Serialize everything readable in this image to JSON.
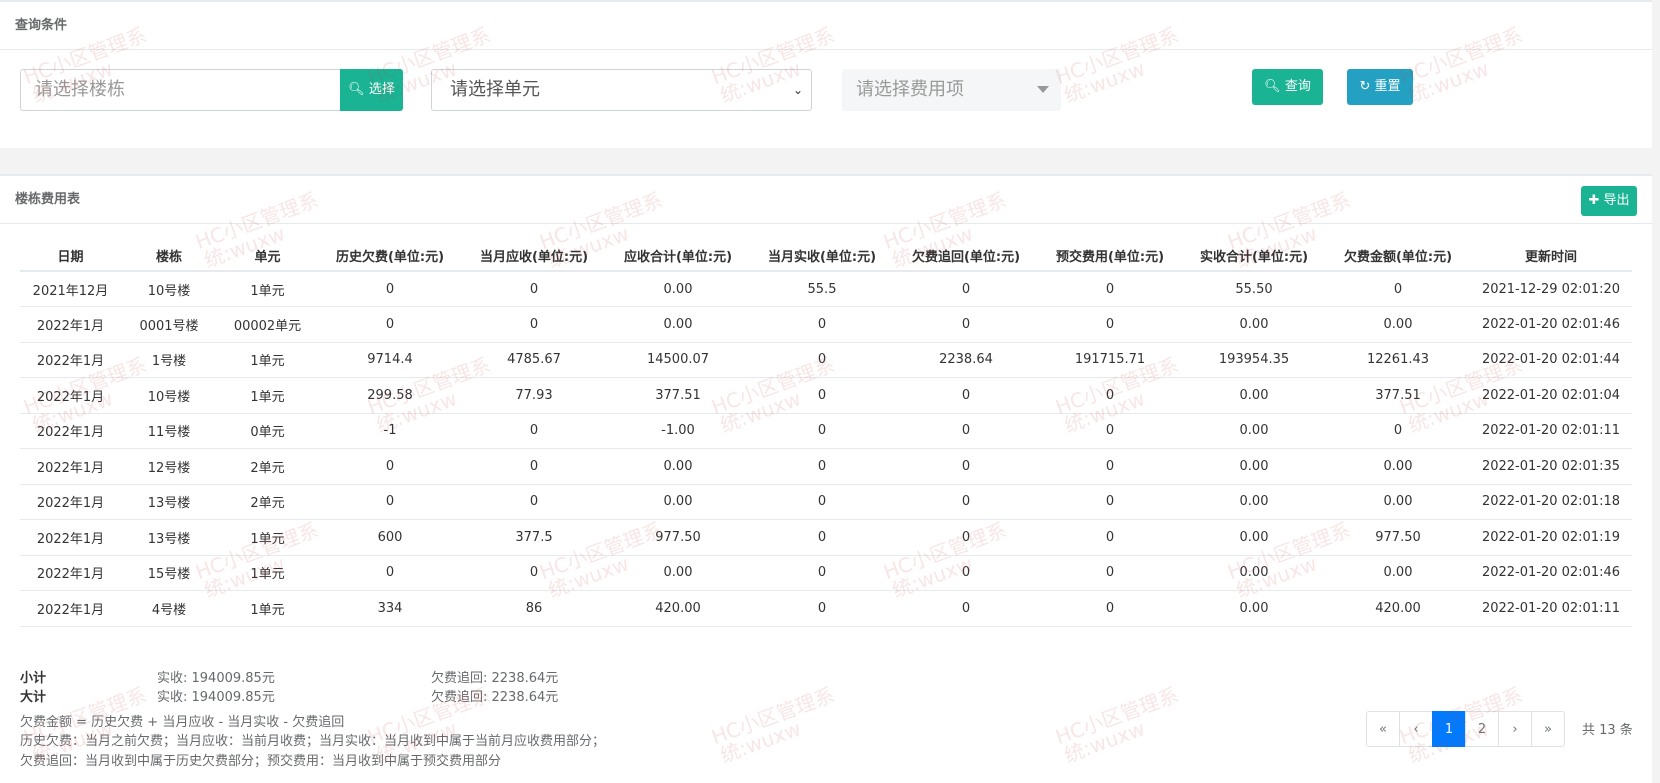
{
  "query": {
    "title": "查询条件",
    "building_placeholder": "请选择楼栋",
    "select_label": "选择",
    "unit_placeholder": "请选择单元",
    "fee_placeholder": "请选择费用项",
    "query_label": "查询",
    "reset_label": "重置"
  },
  "table": {
    "title": "楼栋费用表",
    "export_label": "导出",
    "headers": [
      "日期",
      "楼栋",
      "单元",
      "历史欠费(单位:元)",
      "当月应收(单位:元)",
      "应收合计(单位:元)",
      "当月实收(单位:元)",
      "欠费追回(单位:元)",
      "预交费用(单位:元)",
      "实收合计(单位:元)",
      "欠费金额(单位:元)",
      "更新时间"
    ],
    "rows": [
      [
        "2021年12月",
        "10号楼",
        "1单元",
        "0",
        "0",
        "0.00",
        "55.5",
        "0",
        "0",
        "55.50",
        "0",
        "2021-12-29 02:01:20"
      ],
      [
        "2022年1月",
        "0001号楼",
        "00002单元",
        "0",
        "0",
        "0.00",
        "0",
        "0",
        "0",
        "0.00",
        "0.00",
        "2022-01-20 02:01:46"
      ],
      [
        "2022年1月",
        "1号楼",
        "1单元",
        "9714.4",
        "4785.67",
        "14500.07",
        "0",
        "2238.64",
        "191715.71",
        "193954.35",
        "12261.43",
        "2022-01-20 02:01:44"
      ],
      [
        "2022年1月",
        "10号楼",
        "1单元",
        "299.58",
        "77.93",
        "377.51",
        "0",
        "0",
        "0",
        "0.00",
        "377.51",
        "2022-01-20 02:01:04"
      ],
      [
        "2022年1月",
        "11号楼",
        "0单元",
        "-1",
        "0",
        "-1.00",
        "0",
        "0",
        "0",
        "0.00",
        "0",
        "2022-01-20 02:01:11"
      ],
      [
        "2022年1月",
        "12号楼",
        "2单元",
        "0",
        "0",
        "0.00",
        "0",
        "0",
        "0",
        "0.00",
        "0.00",
        "2022-01-20 02:01:35"
      ],
      [
        "2022年1月",
        "13号楼",
        "2单元",
        "0",
        "0",
        "0.00",
        "0",
        "0",
        "0",
        "0.00",
        "0.00",
        "2022-01-20 02:01:18"
      ],
      [
        "2022年1月",
        "13号楼",
        "1单元",
        "600",
        "377.5",
        "977.50",
        "0",
        "0",
        "0",
        "0.00",
        "977.50",
        "2022-01-20 02:01:19"
      ],
      [
        "2022年1月",
        "15号楼",
        "1单元",
        "0",
        "0",
        "0.00",
        "0",
        "0",
        "0",
        "0.00",
        "0.00",
        "2022-01-20 02:01:46"
      ],
      [
        "2022年1月",
        "4号楼",
        "1单元",
        "334",
        "86",
        "420.00",
        "0",
        "0",
        "0",
        "0.00",
        "420.00",
        "2022-01-20 02:01:11"
      ]
    ]
  },
  "summary": {
    "subtotal_label": "小计",
    "subtotal_paid": "实收: 194009.85元",
    "subtotal_recovered": "欠费追回: 2238.64元",
    "total_label": "大计",
    "total_paid": "实收: 194009.85元",
    "total_recovered": "欠费追回: 2238.64元",
    "note1": "欠费金额 = 历史欠费 + 当月应收 - 当月实收 - 欠费追回",
    "note2": "历史欠费：当月之前欠费；当月应收：当前月收费；当月实收：当月收到中属于当前月应收费用部分；",
    "note3": "欠费追回：当月收到中属于历史欠费部分；预交费用：当月收到中属于预交费用部分"
  },
  "pagination": {
    "first": "«",
    "prev": "‹",
    "pages": [
      "1",
      "2"
    ],
    "next": "›",
    "last": "»",
    "total": "共 13 条"
  },
  "watermark": {
    "line1": "HC小区管理系",
    "line2": "统:wuxw"
  },
  "colors": {
    "primary": "#1ab394",
    "info": "#23a0c2",
    "page_active": "#007bff"
  }
}
